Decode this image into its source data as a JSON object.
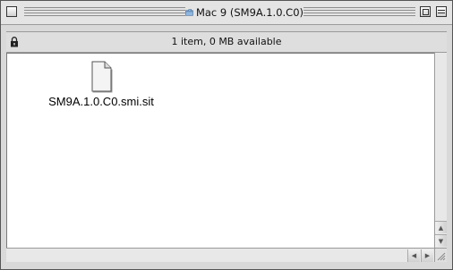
{
  "window": {
    "title": "Mac 9 (SM9A.1.0.C0)",
    "icons": {
      "close": "close-box-icon",
      "zoom": "zoom-box-icon",
      "collapse": "collapse-box-icon",
      "title": "folder-icon",
      "lock": "lock-icon"
    }
  },
  "infobar": {
    "status": "1 item, 0 MB available"
  },
  "files": [
    {
      "name": "SM9A.1.0.C0.smi.sit",
      "icon": "document-icon"
    }
  ],
  "scrollbars": {
    "vertical": {
      "up": "▲",
      "down": "▼"
    },
    "horizontal": {
      "left": "◀",
      "right": "▶"
    }
  }
}
